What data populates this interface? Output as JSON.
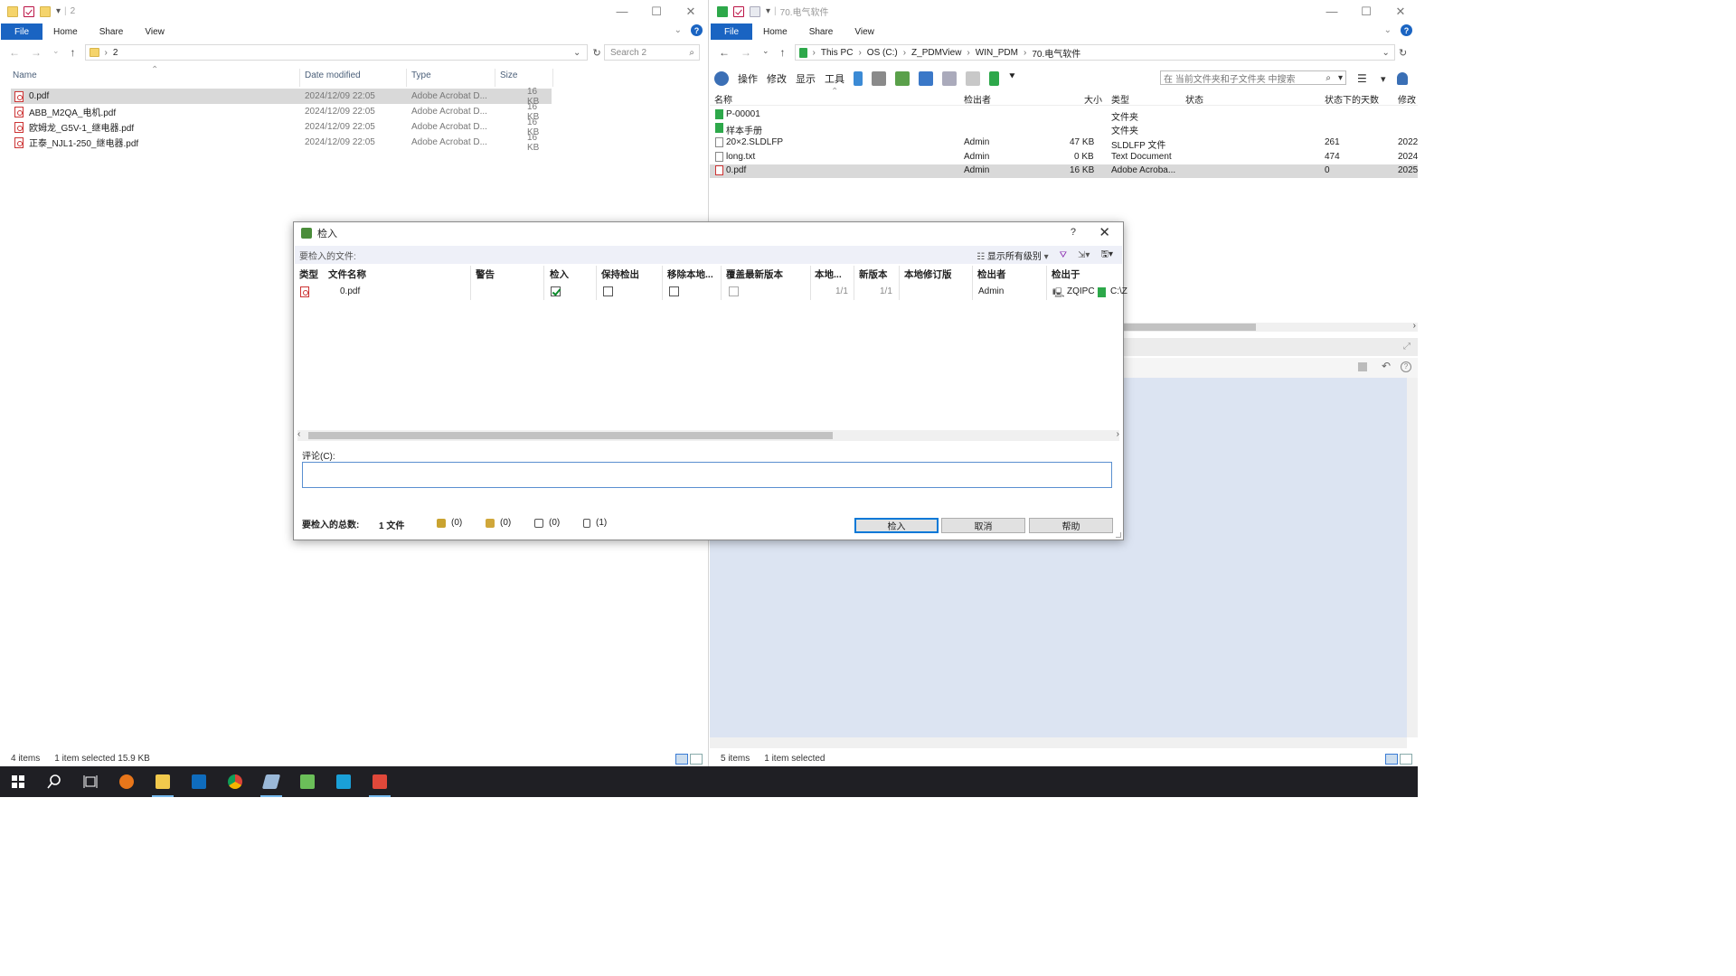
{
  "left_window": {
    "title": "2",
    "ribbon": {
      "file": "File",
      "home": "Home",
      "share": "Share",
      "view": "View"
    },
    "address": "2",
    "search_placeholder": "Search 2",
    "columns": {
      "name": "Name",
      "date": "Date modified",
      "type": "Type",
      "size": "Size"
    },
    "files": [
      {
        "name": "0.pdf",
        "date": "2024/12/09 22:05",
        "type": "Adobe Acrobat D...",
        "size": "16 KB",
        "selected": true
      },
      {
        "name": "ABB_M2QA_电机.pdf",
        "date": "2024/12/09 22:05",
        "type": "Adobe Acrobat D...",
        "size": "16 KB"
      },
      {
        "name": "欧姆龙_G5V-1_继电器.pdf",
        "date": "2024/12/09 22:05",
        "type": "Adobe Acrobat D...",
        "size": "16 KB"
      },
      {
        "name": "正泰_NJL1-250_继电器.pdf",
        "date": "2024/12/09 22:05",
        "type": "Adobe Acrobat D...",
        "size": "16 KB"
      }
    ],
    "status": {
      "count": "4 items",
      "selection": "1 item selected  15.9 KB"
    }
  },
  "right_window": {
    "title": "70.电气软件",
    "ribbon": {
      "file": "File",
      "home": "Home",
      "share": "Share",
      "view": "View"
    },
    "breadcrumb": [
      "This PC",
      "OS (C:)",
      "Z_PDMView",
      "WIN_PDM",
      "70.电气软件"
    ],
    "toolbar": {
      "ops": "操作",
      "modify": "修改",
      "display": "显示",
      "tools": "工具"
    },
    "search_placeholder": "在 当前文件夹和子文件夹 中搜索",
    "columns": {
      "name": "名称",
      "checked_out_by": "检出者",
      "size": "大小",
      "type": "类型",
      "state": "状态",
      "days": "状态下的天数",
      "modified": "修改"
    },
    "files": [
      {
        "name": "P-00001",
        "by": "",
        "size": "",
        "type": "文件夹",
        "state": "",
        "days": "",
        "mod": "",
        "kind": "folder"
      },
      {
        "name": "样本手册",
        "by": "",
        "size": "",
        "type": "文件夹",
        "state": "",
        "days": "",
        "mod": "",
        "kind": "folder"
      },
      {
        "name": "20×2.SLDLFP",
        "by": "Admin",
        "size": "47 KB",
        "type": "SLDLFP 文件",
        "state": "",
        "days": "261",
        "mod": "2022.",
        "kind": "file"
      },
      {
        "name": "long.txt",
        "by": "Admin",
        "size": "0 KB",
        "type": "Text Document",
        "state": "",
        "days": "474",
        "mod": "2024.",
        "kind": "file"
      },
      {
        "name": "0.pdf",
        "by": "Admin",
        "size": "16 KB",
        "type": "Adobe Acroba...",
        "state": "",
        "days": "0",
        "mod": "2025.",
        "kind": "pdf",
        "selected": true
      }
    ],
    "status": {
      "count": "5 items",
      "selection": "1 item selected"
    }
  },
  "dialog": {
    "title": "检入",
    "help": "?",
    "files_label": "要检入的文件:",
    "show_levels": "显示所有级别",
    "columns": {
      "type": "类型",
      "filename": "文件名称",
      "warning": "警告",
      "checkin": "检入",
      "keep_checked_out": "保持检出",
      "remove_local": "移除本地...",
      "overwrite_latest": "覆盖最新版本",
      "local_ver": "本地...",
      "new_ver": "新版本",
      "local_rev": "本地修订版",
      "checked_out_by": "检出者",
      "checked_out_on": "检出于"
    },
    "row": {
      "filename": "0.pdf",
      "local": "1/1",
      "new": "1/1",
      "by": "Admin",
      "computer": "ZQIPC",
      "path": "C:\\Z"
    },
    "comment_label": "评论(C):",
    "total_label": "要检入的总数:",
    "total_value": "1 文件",
    "counts": [
      "(0)",
      "(0)",
      "(0)",
      "(1)"
    ],
    "buttons": {
      "ok": "检入",
      "cancel": "取消",
      "help": "帮助"
    }
  }
}
